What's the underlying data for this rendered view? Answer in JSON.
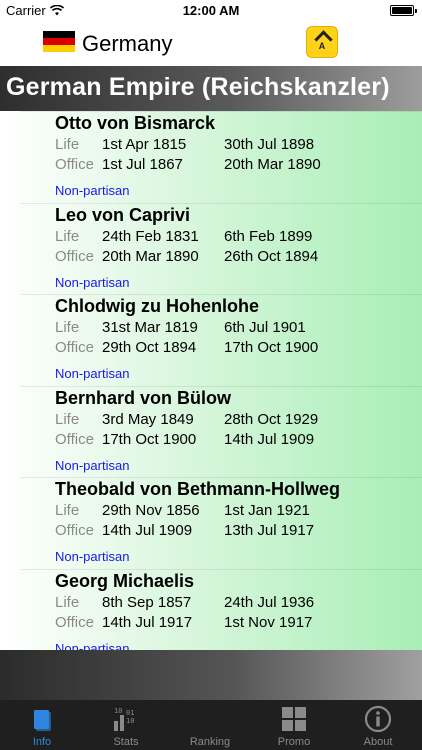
{
  "status_bar": {
    "carrier": "Carrier",
    "time": "12:00 AM"
  },
  "nav": {
    "country": "Germany",
    "flag_colors": [
      "#000000",
      "#dd0000",
      "#ffce00"
    ],
    "app_icon_letter": "A"
  },
  "title": "German Empire (Reichskanzler)",
  "labels": {
    "life": "Life",
    "office": "Office"
  },
  "entries": [
    {
      "name": "Otto von Bismarck",
      "life_start": "1st Apr 1815",
      "life_end": "30th Jul 1898",
      "office_start": "1st Jul 1867",
      "office_end": "20th Mar 1890",
      "party": "Non-partisan"
    },
    {
      "name": "Leo von Caprivi",
      "life_start": "24th Feb 1831",
      "life_end": "6th Feb 1899",
      "office_start": "20th Mar 1890",
      "office_end": "26th Oct 1894",
      "party": "Non-partisan"
    },
    {
      "name": "Chlodwig zu Hohenlohe",
      "life_start": "31st Mar 1819",
      "life_end": "6th Jul 1901",
      "office_start": "29th Oct 1894",
      "office_end": "17th Oct 1900",
      "party": "Non-partisan"
    },
    {
      "name": "Bernhard von Bülow",
      "life_start": "3rd May 1849",
      "life_end": "28th Oct 1929",
      "office_start": "17th Oct 1900",
      "office_end": "14th Jul 1909",
      "party": "Non-partisan"
    },
    {
      "name": "Theobald von Bethmann-Hollweg",
      "life_start": "29th Nov 1856",
      "life_end": "1st Jan 1921",
      "office_start": "14th Jul 1909",
      "office_end": "13th Jul 1917",
      "party": "Non-partisan"
    },
    {
      "name": "Georg Michaelis",
      "life_start": "8th Sep 1857",
      "life_end": "24th Jul 1936",
      "office_start": "14th Jul 1917",
      "office_end": "1st Nov 1917",
      "party": "Non-partisan"
    }
  ],
  "tabs": [
    {
      "label": "Info",
      "icon": "book-icon",
      "active": true
    },
    {
      "label": "Stats",
      "icon": "stats-icon",
      "active": false
    },
    {
      "label": "Ranking",
      "icon": "ranking-icon",
      "active": false
    },
    {
      "label": "Promo",
      "icon": "grid-icon",
      "active": false
    },
    {
      "label": "About",
      "icon": "info-icon",
      "active": false
    }
  ],
  "colors": {
    "active_tab": "#2f86e0",
    "party_link": "#1a1ae6"
  }
}
